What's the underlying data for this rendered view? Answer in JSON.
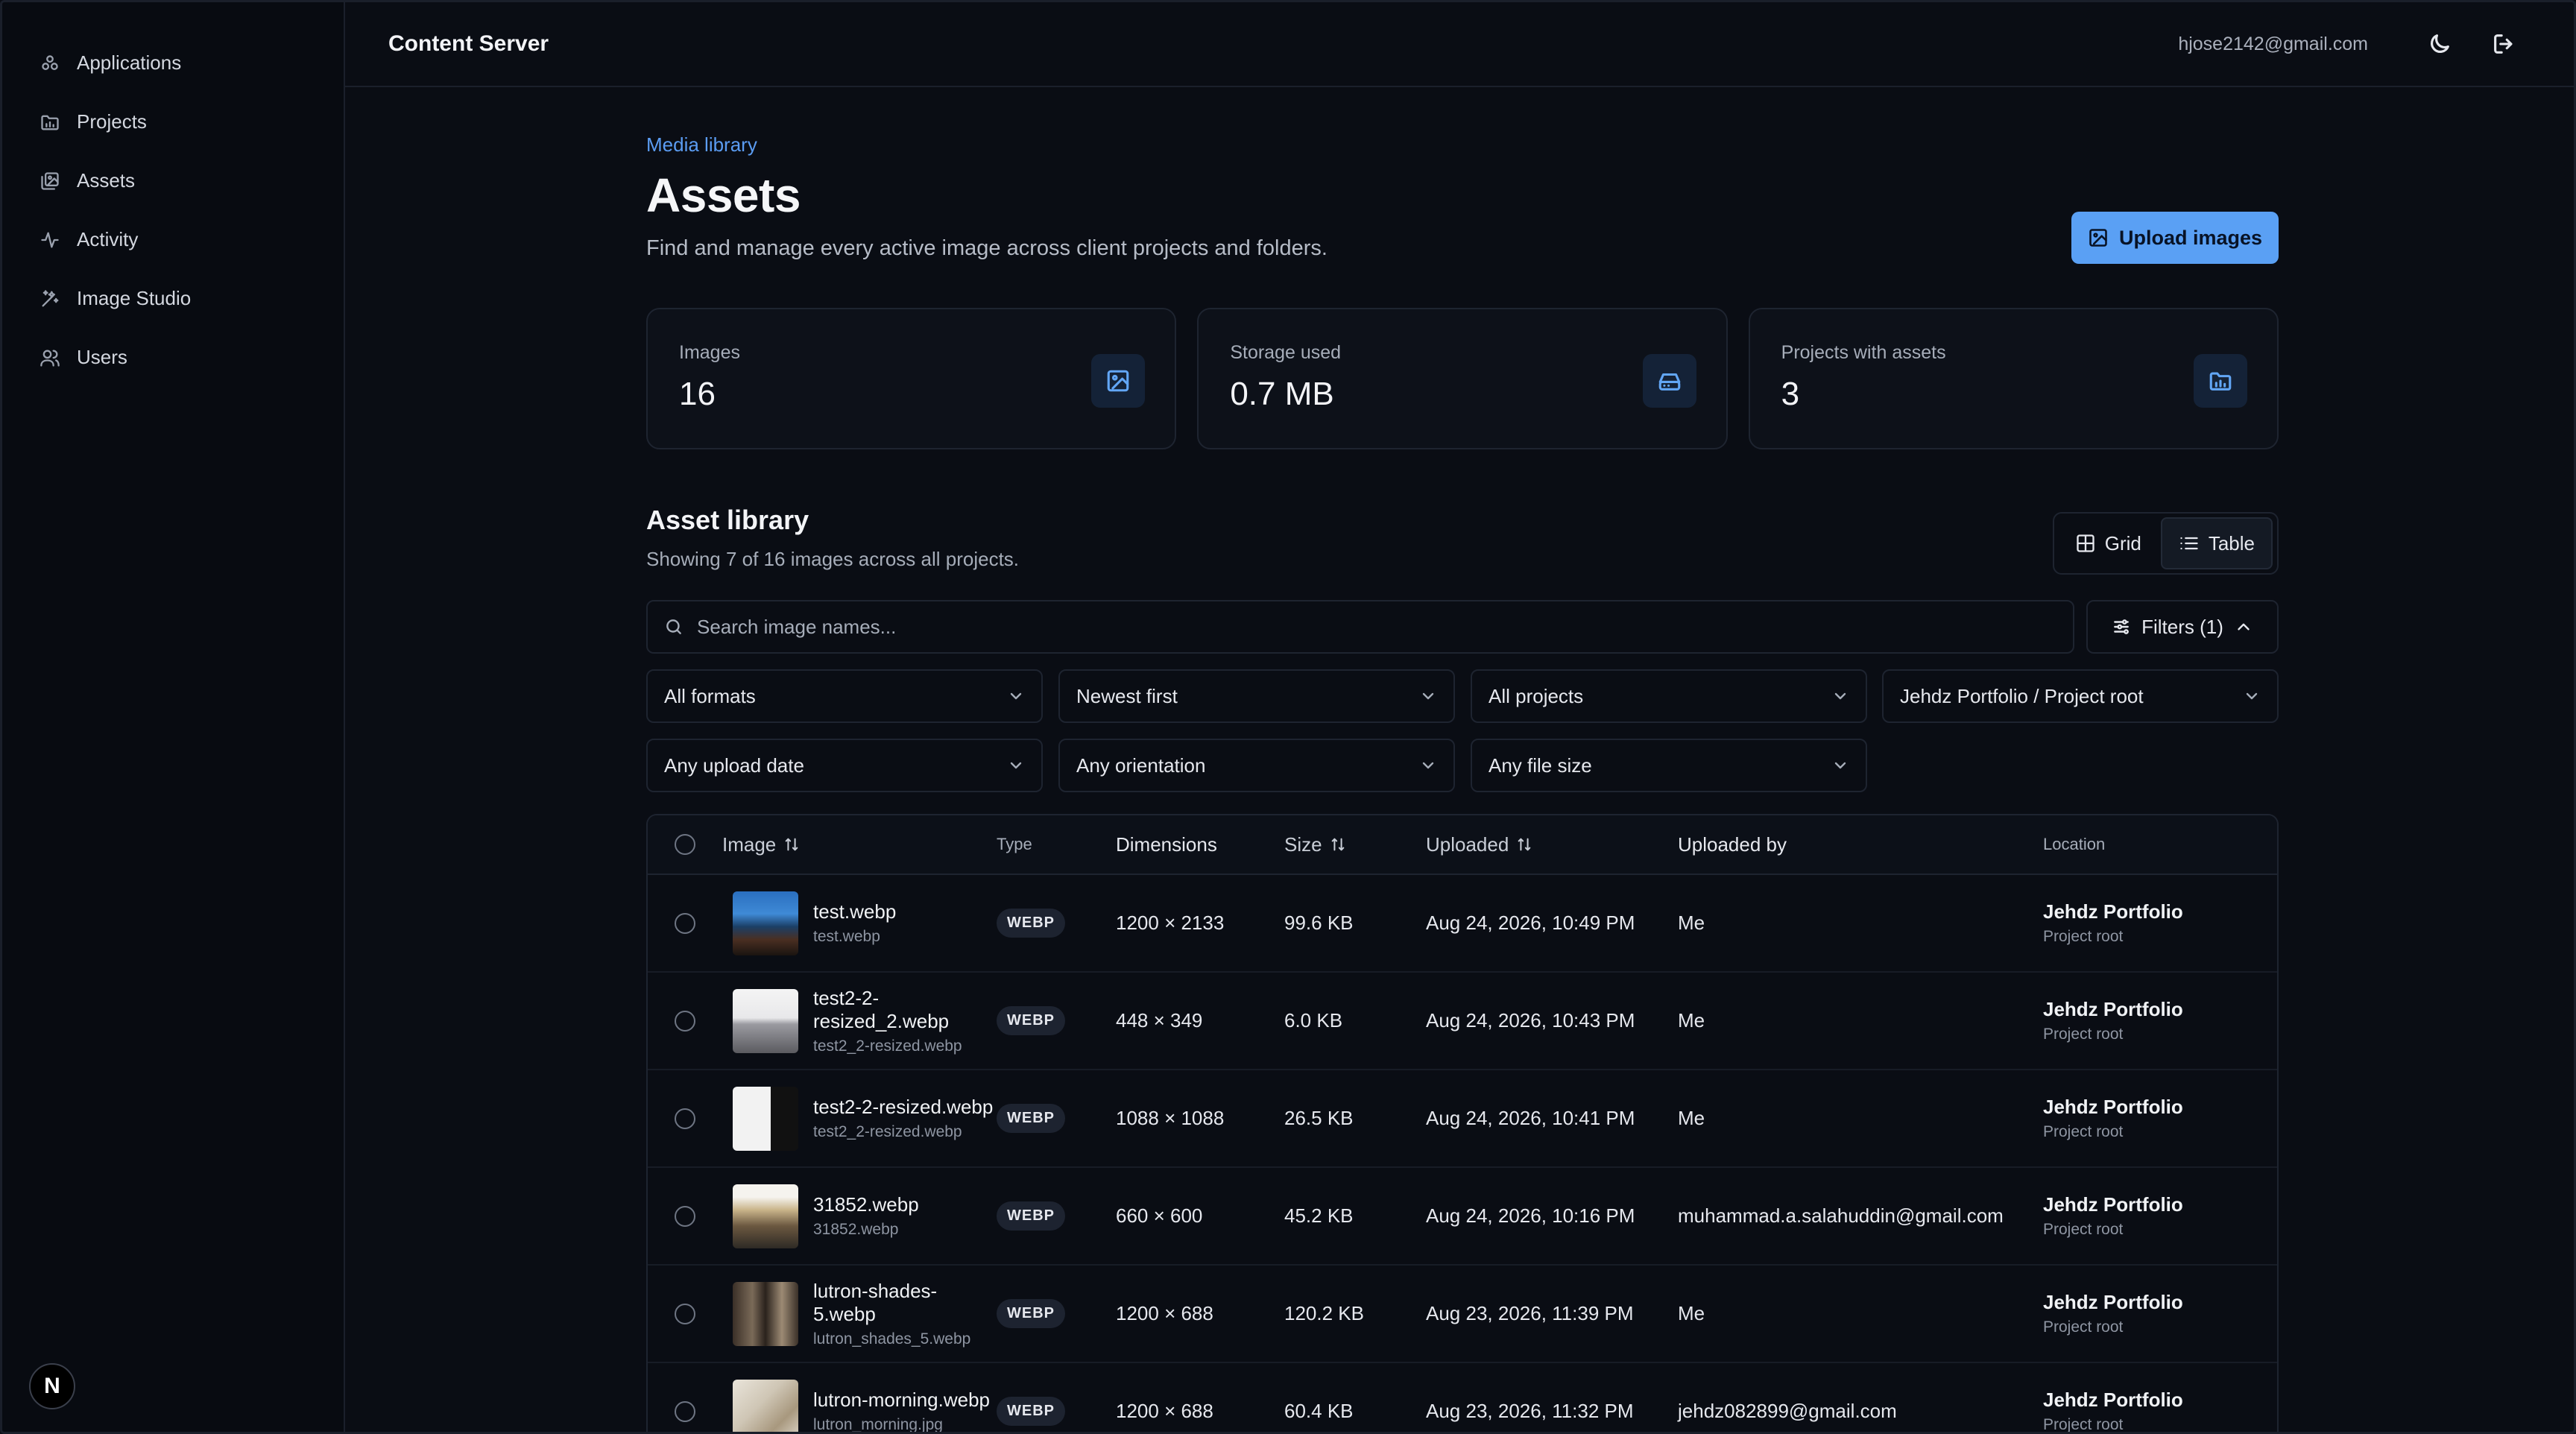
{
  "sidebar": {
    "items": [
      {
        "label": "Applications",
        "icon": "applications-icon"
      },
      {
        "label": "Projects",
        "icon": "folder-icon"
      },
      {
        "label": "Assets",
        "icon": "images-icon"
      },
      {
        "label": "Activity",
        "icon": "activity-icon"
      },
      {
        "label": "Image Studio",
        "icon": "wand-icon"
      },
      {
        "label": "Users",
        "icon": "users-icon"
      }
    ],
    "badge": "N"
  },
  "topbar": {
    "title": "Content Server",
    "email": "hjose2142@gmail.com"
  },
  "header": {
    "eyebrow": "Media library",
    "title": "Assets",
    "subtitle": "Find and manage every active image across client projects and folders.",
    "upload_label": "Upload images"
  },
  "stats": [
    {
      "label": "Images",
      "value": "16"
    },
    {
      "label": "Storage used",
      "value": "0.7 MB"
    },
    {
      "label": "Projects with assets",
      "value": "3"
    }
  ],
  "library": {
    "title": "Asset library",
    "subtitle": "Showing 7 of 16 images across all projects.",
    "view_grid": "Grid",
    "view_table": "Table",
    "search_placeholder": "Search image names...",
    "filters_label": "Filters (1)",
    "selects": [
      "All formats",
      "Newest first",
      "All projects",
      "Jehdz Portfolio / Project root",
      "Any upload date",
      "Any orientation",
      "Any file size"
    ]
  },
  "table": {
    "headers": {
      "image": "Image",
      "type": "Type",
      "dimensions": "Dimensions",
      "size": "Size",
      "uploaded": "Uploaded",
      "uploaded_by": "Uploaded by",
      "location": "Location"
    },
    "rows": [
      {
        "name": "test.webp",
        "file": "test.webp",
        "type": "WEBP",
        "dimensions": "1200 × 2133",
        "size": "99.6 KB",
        "uploaded": "Aug 24, 2026, 10:49 PM",
        "by": "Me",
        "location": "Jehdz Portfolio",
        "folder": "Project root"
      },
      {
        "name": "test2-2-resized_2.webp",
        "file": "test2_2-resized.webp",
        "type": "WEBP",
        "dimensions": "448 × 349",
        "size": "6.0 KB",
        "uploaded": "Aug 24, 2026, 10:43 PM",
        "by": "Me",
        "location": "Jehdz Portfolio",
        "folder": "Project root"
      },
      {
        "name": "test2-2-resized.webp",
        "file": "test2_2-resized.webp",
        "type": "WEBP",
        "dimensions": "1088 × 1088",
        "size": "26.5 KB",
        "uploaded": "Aug 24, 2026, 10:41 PM",
        "by": "Me",
        "location": "Jehdz Portfolio",
        "folder": "Project root"
      },
      {
        "name": "31852.webp",
        "file": "31852.webp",
        "type": "WEBP",
        "dimensions": "660 × 600",
        "size": "45.2 KB",
        "uploaded": "Aug 24, 2026, 10:16 PM",
        "by": "muhammad.a.salahuddin@gmail.com",
        "location": "Jehdz Portfolio",
        "folder": "Project root"
      },
      {
        "name": "lutron-shades-5.webp",
        "file": "lutron_shades_5.webp",
        "type": "WEBP",
        "dimensions": "1200 × 688",
        "size": "120.2 KB",
        "uploaded": "Aug 23, 2026, 11:39 PM",
        "by": "Me",
        "location": "Jehdz Portfolio",
        "folder": "Project root"
      },
      {
        "name": "lutron-morning.webp",
        "file": "lutron_morning.jpg",
        "type": "WEBP",
        "dimensions": "1200 × 688",
        "size": "60.4 KB",
        "uploaded": "Aug 23, 2026, 11:32 PM",
        "by": "jehdz082899@gmail.com",
        "location": "Jehdz Portfolio",
        "folder": "Project root"
      }
    ]
  },
  "colors": {
    "accent": "#5aa0f4",
    "background": "#0a0d14"
  }
}
